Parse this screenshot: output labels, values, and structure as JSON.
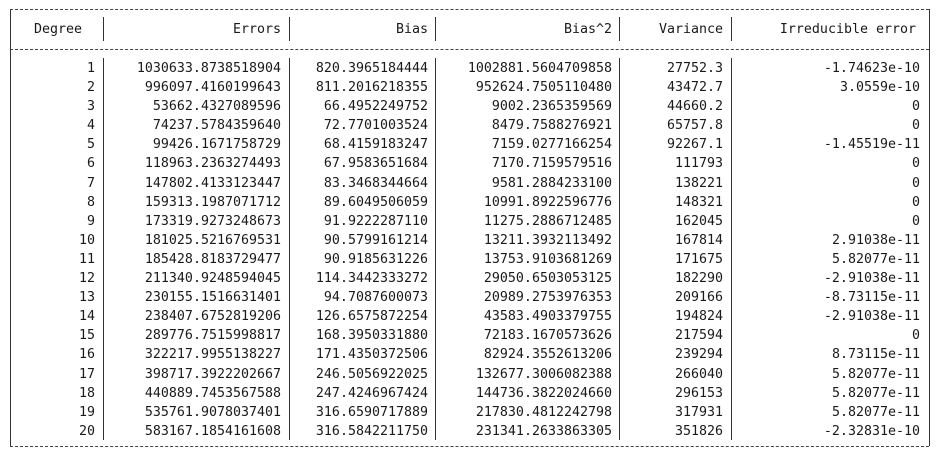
{
  "table": {
    "headers": [
      "Degree",
      "Errors",
      "Bias",
      "Bias^2",
      "Variance",
      "Irreducible error"
    ],
    "rows": [
      [
        "1",
        "1030633.8738518904",
        "820.3965184444",
        "1002881.5604709858",
        "27752.3",
        "-1.74623e-10"
      ],
      [
        "2",
        "996097.4160199643",
        "811.2016218355",
        "952624.7505110480",
        "43472.7",
        "3.0559e-10"
      ],
      [
        "3",
        "53662.4327089596",
        "66.4952249752",
        "9002.2365359569",
        "44660.2",
        "0"
      ],
      [
        "4",
        "74237.5784359640",
        "72.7701003524",
        "8479.7588276921",
        "65757.8",
        "0"
      ],
      [
        "5",
        "99426.1671758729",
        "68.4159183247",
        "7159.0277166254",
        "92267.1",
        "-1.45519e-11"
      ],
      [
        "6",
        "118963.2363274493",
        "67.9583651684",
        "7170.7159579516",
        "111793",
        "0"
      ],
      [
        "7",
        "147802.4133123447",
        "83.3468344664",
        "9581.2884233100",
        "138221",
        "0"
      ],
      [
        "8",
        "159313.1987071712",
        "89.6049506059",
        "10991.8922596776",
        "148321",
        "0"
      ],
      [
        "9",
        "173319.9273248673",
        "91.9222287110",
        "11275.2886712485",
        "162045",
        "0"
      ],
      [
        "10",
        "181025.5216769531",
        "90.5799161214",
        "13211.3932113492",
        "167814",
        "2.91038e-11"
      ],
      [
        "11",
        "185428.8183729477",
        "90.9185631226",
        "13753.9103681269",
        "171675",
        "5.82077e-11"
      ],
      [
        "12",
        "211340.9248594045",
        "114.3442333272",
        "29050.6503053125",
        "182290",
        "-2.91038e-11"
      ],
      [
        "13",
        "230155.1516631401",
        "94.7087600073",
        "20989.2753976353",
        "209166",
        "-8.73115e-11"
      ],
      [
        "14",
        "238407.6752819206",
        "126.6575872254",
        "43583.4903379755",
        "194824",
        "-2.91038e-11"
      ],
      [
        "15",
        "289776.7515998817",
        "168.3950331880",
        "72183.1670573626",
        "217594",
        "0"
      ],
      [
        "16",
        "322217.9955138227",
        "171.4350372506",
        "82924.3552613206",
        "239294",
        "8.73115e-11"
      ],
      [
        "17",
        "398717.3922202667",
        "246.5056922025",
        "132677.3006082388",
        "266040",
        "5.82077e-11"
      ],
      [
        "18",
        "440889.7453567588",
        "247.4246967424",
        "144736.3822024660",
        "296153",
        "5.82077e-11"
      ],
      [
        "19",
        "535761.9078037401",
        "316.6590717889",
        "217830.4812242798",
        "317931",
        "5.82077e-11"
      ],
      [
        "20",
        "583167.1854161608",
        "316.5842211750",
        "231341.2633863305",
        "351826",
        "-2.32831e-10"
      ]
    ]
  }
}
